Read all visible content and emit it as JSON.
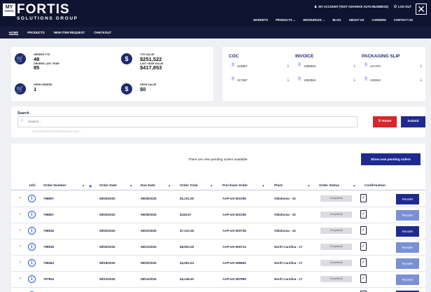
{
  "header": {
    "logo_box": "MY",
    "logo_box_sub": "FORTIS",
    "logo_main": "FORTIS",
    "logo_sub": "SOLUTIONS GROUP",
    "account_link": "MY ACCOUNT (TEST ADVANCE AUTO BUSINESS)",
    "logout_link": "LOG OUT",
    "menu": [
      "MARKETS",
      "PRODUCTS ⌄",
      "RESOURCES ⌄",
      "BLOG",
      "ABOUT US",
      "CAREERS",
      "CONTACT US"
    ]
  },
  "subnav": [
    "HOME",
    "PRODUCTS",
    "NEW ITEM REQUEST",
    "CHECKOUT"
  ],
  "stats": {
    "orders_ytd_label": "ORDERS YTD",
    "orders_ytd": "48",
    "orders_last_year_label": "ORDERS LAST YEAR",
    "orders_last_year": "85",
    "ytd_value_label": "YTD VALUE",
    "ytd_value": "$251,522",
    "last_year_value_label": "LAST YEAR VALUE",
    "last_year_value": "$417,853",
    "open_orders_label": "OPEN ORDERS",
    "open_orders": "1",
    "open_value_label": "OPEN VALUE",
    "open_value": "$0"
  },
  "documents": {
    "coc": {
      "title": "COC",
      "items": [
        "415867",
        "417967"
      ]
    },
    "invoice": {
      "title": "INVOICE",
      "items": [
        "1395083",
        "1393084"
      ]
    },
    "packing": {
      "title": "PACKAGING SLIP",
      "items": [
        "417476",
        "415919"
      ]
    }
  },
  "search": {
    "title": "Search",
    "placeholder": "Search...",
    "hint": "LAST 5 MONTHS RECORDS IN RESULT-SET ▾",
    "reset": "Reset",
    "submit": "Submit"
  },
  "orders": {
    "pending_message": "There are new pending orders available.",
    "show_pending": "Show new pending orders",
    "columns": [
      "Info",
      "Order Number",
      "Order Date",
      "Due Date",
      "Order Total",
      "Purchase Order",
      "Plant",
      "Order Status",
      "Confirmation"
    ],
    "rows": [
      {
        "number": "798857",
        "order_date": "08/25/2025",
        "due_date": "08/29/2025",
        "total": "$2,101.05",
        "po": "AAP-US-502195",
        "plant": "Oklahoma - 22",
        "status": "Completed",
        "reorder": "Reorder",
        "reorder_style": "dark"
      },
      {
        "number": "798857",
        "order_date": "08/25/2025",
        "due_date": "08/29/2025",
        "total": "$418.67",
        "po": "AAP-US-502195",
        "plant": "Oklahoma - 22",
        "status": "Completed",
        "reorder": "Reorder",
        "reorder_style": "light"
      },
      {
        "number": "798536",
        "order_date": "08/20/2025",
        "due_date": "08/22/2025",
        "total": "$7,210.36",
        "po": "AAP-US-500736",
        "plant": "Oklahoma - 22",
        "status": "Completed",
        "reorder": "Reorder",
        "reorder_style": "dark"
      },
      {
        "number": "798535",
        "order_date": "08/20/2025",
        "due_date": "08/21/2025",
        "total": "$8,503.29",
        "po": "AAP-US-500712",
        "plant": "North Carolina - 17",
        "status": "Completed",
        "reorder": "Reorder",
        "reorder_style": "light"
      },
      {
        "number": "798364",
        "order_date": "08/18/2025",
        "due_date": "08/20/2025",
        "total": "$4,551.04",
        "po": "AAP-US-499662",
        "plant": "North Carolina - 17",
        "status": "Completed",
        "reorder": "Reorder",
        "reorder_style": "light"
      },
      {
        "number": "797834",
        "order_date": "08/12/2025",
        "due_date": "08/14/2025",
        "total": "$4,148.40",
        "po": "AAP-US-497809",
        "plant": "North Carolina - 17",
        "status": "Completed",
        "reorder": "Reorder",
        "reorder_style": "light"
      },
      {
        "number": "797772",
        "order_date": "08/11/2025",
        "due_date": "08/29/2025",
        "total": "$1,637.12",
        "po": "AAP-US-497318",
        "plant": "Oklahoma - 22",
        "status": "Completed",
        "reorder": "Reorder",
        "reorder_style": "dark"
      }
    ]
  }
}
